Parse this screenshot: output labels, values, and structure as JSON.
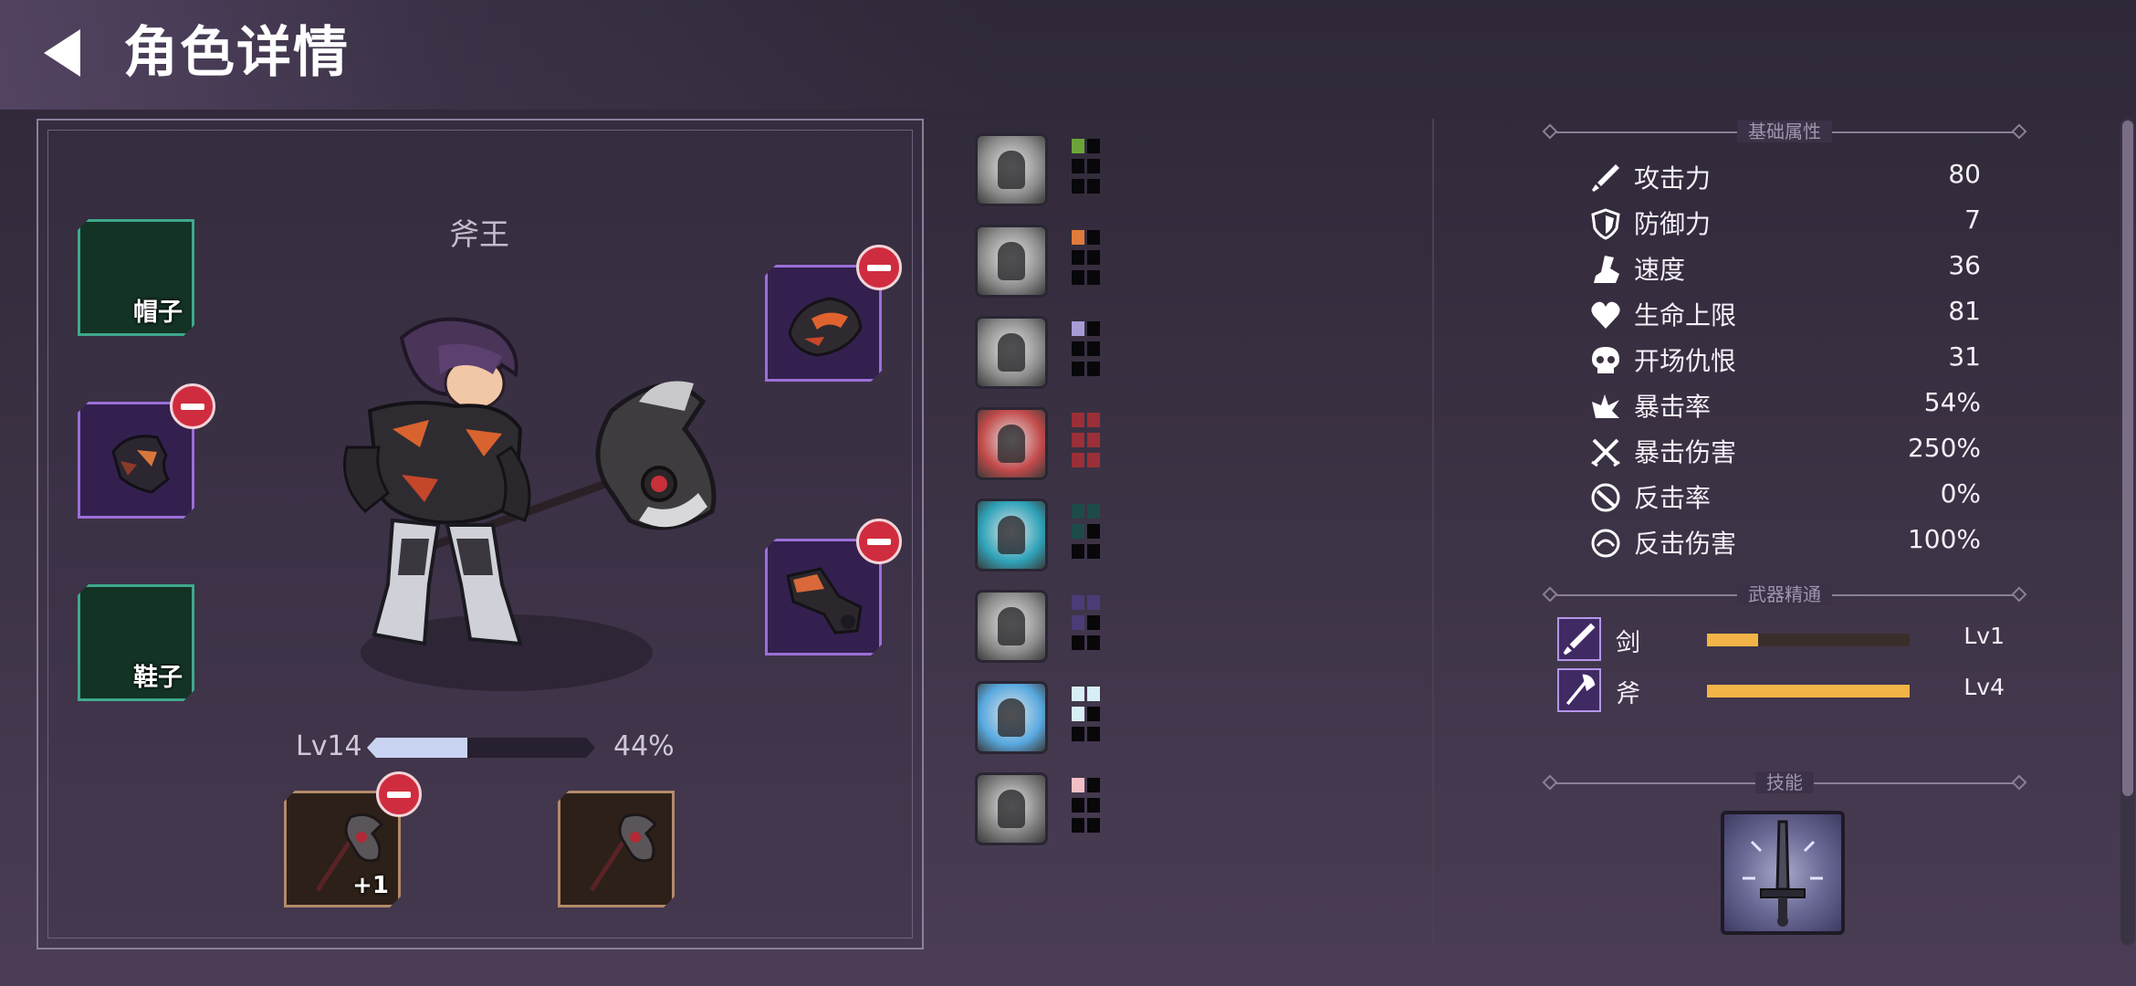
{
  "header": {
    "title": "角色详情",
    "back_icon": "back-arrow-icon"
  },
  "character": {
    "name": "斧王",
    "level": "Lv14",
    "xp_percent": "44%",
    "xp_fraction": 0.44
  },
  "equipment": {
    "hat": {
      "label": "帽子",
      "state": "empty"
    },
    "helmet": {
      "state": "equipped",
      "icon": "helmet-icon"
    },
    "boots": {
      "label": "鞋子",
      "state": "empty"
    },
    "shoulder": {
      "state": "equipped",
      "icon": "shoulder-armor-icon"
    },
    "gauntlet": {
      "state": "equipped",
      "icon": "gauntlet-icon"
    },
    "weapon_main": {
      "icon": "axe-icon",
      "enhance": "+1"
    },
    "weapon_off": {
      "icon": "axe-icon"
    }
  },
  "talents": [
    {
      "icon": "cheering-figure-icon",
      "color": "#6da43a",
      "filled": 1
    },
    {
      "icon": "knight-sword-icon",
      "color": "#e07b3a",
      "filled": 1
    },
    {
      "icon": "shield-warrior-icon",
      "color": "#a79cd6",
      "filled": 1
    },
    {
      "icon": "rage-head-icon",
      "color": "#9b2f37",
      "filled": 6
    },
    {
      "icon": "blade-strike-icon",
      "color": "#1d4b4a",
      "filled": 3
    },
    {
      "icon": "axe-silhouette-icon",
      "color": "#4a3c77",
      "filled": 3
    },
    {
      "icon": "winged-shield-icon",
      "color": "#d8eef6",
      "filled": 3
    },
    {
      "icon": "crossed-swords-icon",
      "color": "#f2c0c4",
      "filled": 1
    }
  ],
  "stats_section": {
    "title": "基础属性",
    "stats": [
      {
        "icon": "sword-icon",
        "name": "攻击力",
        "value": "80"
      },
      {
        "icon": "shield-icon",
        "name": "防御力",
        "value": "7"
      },
      {
        "icon": "boot-icon",
        "name": "速度",
        "value": "36"
      },
      {
        "icon": "heart-icon",
        "name": "生命上限",
        "value": "81"
      },
      {
        "icon": "skull-icon",
        "name": "开场仇恨",
        "value": "31"
      },
      {
        "icon": "crit-burst-icon",
        "name": "暴击率",
        "value": "54%"
      },
      {
        "icon": "crossed-blades-icon",
        "name": "暴击伤害",
        "value": "250%"
      },
      {
        "icon": "counter-icon",
        "name": "反击率",
        "value": "0%"
      },
      {
        "icon": "counter-damage-icon",
        "name": "反击伤害",
        "value": "100%"
      }
    ]
  },
  "mastery_section": {
    "title": "武器精通",
    "items": [
      {
        "icon": "sword-icon",
        "name": "剑",
        "level": "Lv1",
        "progress": 0.25
      },
      {
        "icon": "axe-icon",
        "name": "斧",
        "level": "Lv4",
        "progress": 1.0
      }
    ]
  },
  "skills_section": {
    "title": "技能",
    "skill_icon": "glowing-sword-icon"
  },
  "colors": {
    "empty_slot": "#133325",
    "equipped_slot": "#33204f",
    "remove_badge": "#d02c3f",
    "mastery_bar": "#f3b447",
    "xp_bar": "#c9d4f2"
  }
}
